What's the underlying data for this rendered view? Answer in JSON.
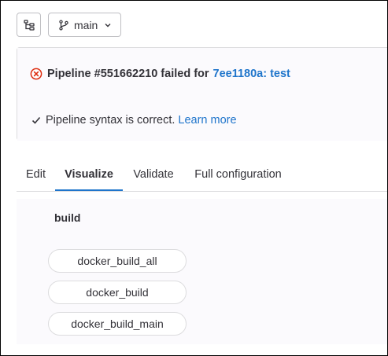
{
  "toolbar": {
    "tree_icon": "file-tree-icon",
    "branch_icon": "branch-icon",
    "branch_label": "main",
    "chevron_icon": "chevron-down-icon"
  },
  "status": {
    "fail_icon": "status-failed-icon",
    "pipeline_text": "Pipeline #551662210 failed for",
    "commit_link": "7ee1180a: test",
    "check_icon": "check-icon",
    "syntax_text": "Pipeline syntax is correct.",
    "learn_more": "Learn more"
  },
  "tabs": [
    {
      "label": "Edit",
      "active": false
    },
    {
      "label": "Visualize",
      "active": true
    },
    {
      "label": "Validate",
      "active": false
    },
    {
      "label": "Full configuration",
      "active": false
    }
  ],
  "visualize": {
    "stage": "build",
    "jobs": [
      "docker_build_all",
      "docker_build",
      "docker_build_main"
    ]
  },
  "colors": {
    "accent": "#1f75cb",
    "danger": "#dd2b0e",
    "text": "#333238",
    "border": "#dcdcde",
    "panel_bg": "#fbfafd"
  }
}
